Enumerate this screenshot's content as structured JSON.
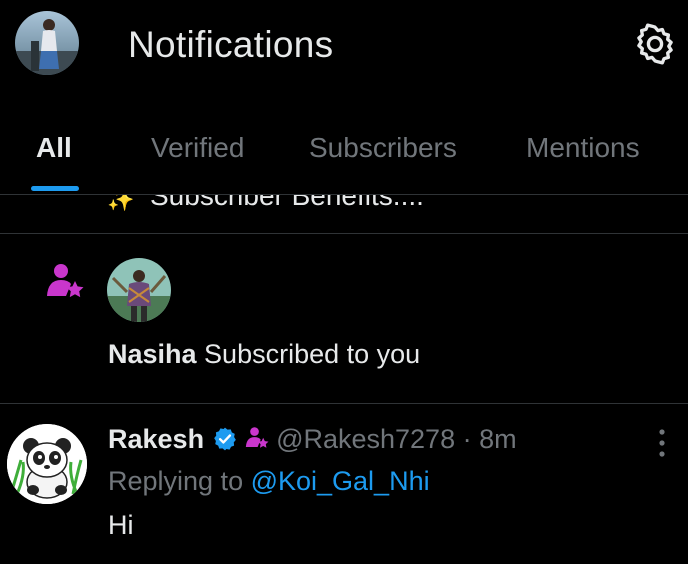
{
  "header": {
    "title": "Notifications",
    "avatar_icon": "user-avatar",
    "settings_icon": "gear-icon"
  },
  "tabs": [
    {
      "label": "All",
      "active": true
    },
    {
      "label": "Verified",
      "active": false
    },
    {
      "label": "Subscribers",
      "active": false
    },
    {
      "label": "Mentions",
      "active": false
    }
  ],
  "truncated_notification": {
    "text": "Subscriber Benefits....",
    "icon": "sparkles-icon"
  },
  "subscription_notification": {
    "icon": "subscriber-star-icon",
    "name": "Nasiha",
    "action": " Subscribed to you"
  },
  "reply_post": {
    "author": "Rakesh",
    "handle": "@Rakesh7278",
    "time_sep": " · ",
    "time": "8m",
    "replying_prefix": "Replying to ",
    "replying_to": "@Koi_Gal_Nhi",
    "body": "Hi",
    "more_icon": "more-vertical-icon"
  },
  "colors": {
    "background": "#000000",
    "text_primary": "#e7e9ea",
    "text_secondary": "#71767b",
    "accent": "#1d9bf0",
    "subscriber_purple": "#c936cc",
    "divider": "#2f3336"
  }
}
